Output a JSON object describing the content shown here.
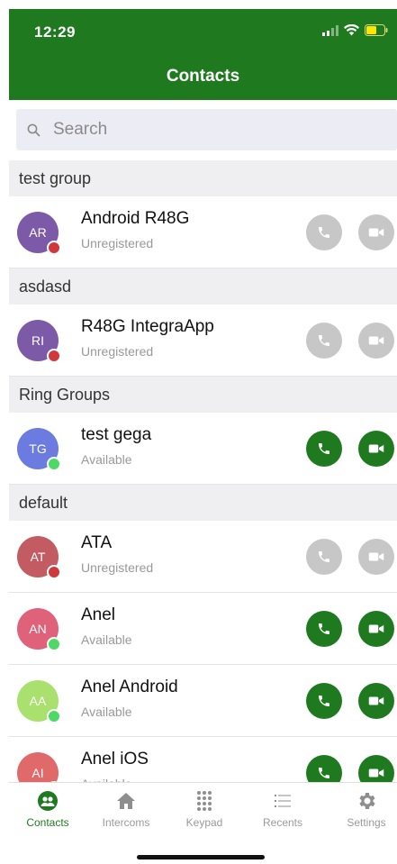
{
  "status_bar": {
    "time": "12:29"
  },
  "header": {
    "title": "Contacts"
  },
  "search": {
    "placeholder": "Search"
  },
  "colors": {
    "brand_green": "#1f7a1f",
    "status_available": "#4cd964",
    "status_unregistered": "#d0393b",
    "button_disabled": "#c7c7c7"
  },
  "groups": [
    {
      "label": "test group",
      "contacts": [
        {
          "initials": "AR",
          "name": "Android R48G",
          "status": "Unregistered",
          "avatar_color": "#7d5aa8",
          "available": false
        }
      ]
    },
    {
      "label": "asdasd",
      "contacts": [
        {
          "initials": "RI",
          "name": "R48G IntegraApp",
          "status": "Unregistered",
          "avatar_color": "#7d5aa8",
          "available": false
        }
      ]
    },
    {
      "label": "Ring Groups",
      "contacts": [
        {
          "initials": "TG",
          "name": "test gega",
          "status": "Available",
          "avatar_color": "#6b7be0",
          "available": true
        }
      ]
    },
    {
      "label": "default",
      "contacts": [
        {
          "initials": "AT",
          "name": "ATA",
          "status": "Unregistered",
          "avatar_color": "#c25c62",
          "available": false
        },
        {
          "initials": "AN",
          "name": "Anel",
          "status": "Available",
          "avatar_color": "#e0617a",
          "available": true
        },
        {
          "initials": "AA",
          "name": "Anel Android",
          "status": "Available",
          "avatar_color": "#a9e06e",
          "available": true
        },
        {
          "initials": "AI",
          "name": "Anel iOS",
          "status": "Available",
          "avatar_color": "#e0696a",
          "available": true
        }
      ]
    }
  ],
  "tabs": [
    {
      "label": "Contacts",
      "icon": "contacts-icon",
      "active": true
    },
    {
      "label": "Intercoms",
      "icon": "home-icon",
      "active": false
    },
    {
      "label": "Keypad",
      "icon": "keypad-icon",
      "active": false
    },
    {
      "label": "Recents",
      "icon": "list-icon",
      "active": false
    },
    {
      "label": "Settings",
      "icon": "gear-icon",
      "active": false
    }
  ]
}
